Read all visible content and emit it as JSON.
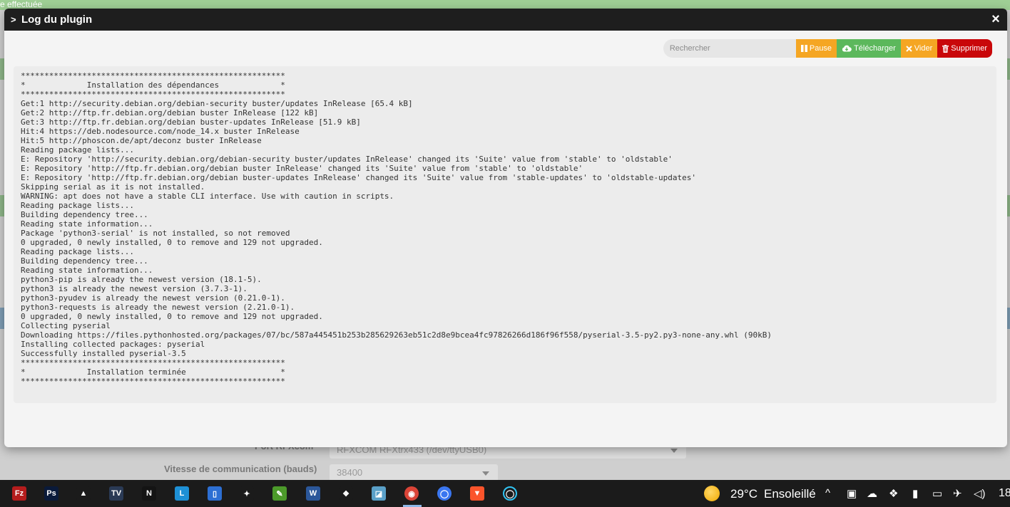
{
  "background": {
    "banner_text": "e effectuée",
    "port_label": "Port RFXcom",
    "port_value": "RFXCOM RFXtrx433 (/dev/ttyUSB0)",
    "speed_label": "Vitesse de communication (bauds)",
    "speed_value": "38400"
  },
  "modal": {
    "title": "Log du plugin",
    "close_glyph": "×",
    "search_placeholder": "Rechercher",
    "buttons": {
      "pause": "Pause",
      "download": "Télécharger",
      "clear": "Vider",
      "delete": "Supprimer"
    },
    "log_lines": [
      "********************************************************",
      "*             Installation des dépendances             *",
      "********************************************************",
      "Get:1 http://security.debian.org/debian-security buster/updates InRelease [65.4 kB]",
      "Get:2 http://ftp.fr.debian.org/debian buster InRelease [122 kB]",
      "Get:3 http://ftp.fr.debian.org/debian buster-updates InRelease [51.9 kB]",
      "Hit:4 https://deb.nodesource.com/node_14.x buster InRelease",
      "Hit:5 http://phoscon.de/apt/deconz buster InRelease",
      "Reading package lists...",
      "E: Repository 'http://security.debian.org/debian-security buster/updates InRelease' changed its 'Suite' value from 'stable' to 'oldstable'",
      "E: Repository 'http://ftp.fr.debian.org/debian buster InRelease' changed its 'Suite' value from 'stable' to 'oldstable'",
      "E: Repository 'http://ftp.fr.debian.org/debian buster-updates InRelease' changed its 'Suite' value from 'stable-updates' to 'oldstable-updates'",
      "Skipping serial as it is not installed.",
      "WARNING: apt does not have a stable CLI interface. Use with caution in scripts.",
      "Reading package lists...",
      "Building dependency tree...",
      "Reading state information...",
      "Package 'python3-serial' is not installed, so not removed",
      "0 upgraded, 0 newly installed, 0 to remove and 129 not upgraded.",
      "Reading package lists...",
      "Building dependency tree...",
      "Reading state information...",
      "python3-pip is already the newest version (18.1-5).",
      "python3 is already the newest version (3.7.3-1).",
      "python3-pyudev is already the newest version (0.21.0-1).",
      "python3-requests is already the newest version (2.21.0-1).",
      "0 upgraded, 0 newly installed, 0 to remove and 129 not upgraded.",
      "Collecting pyserial",
      "Downloading https://files.pythonhosted.org/packages/07/bc/587a445451b253b285629263eb51c2d8e9bcea4fc97826266d186f96f558/pyserial-3.5-py2.py3-none-any.whl (90kB)",
      "Installing collected packages: pyserial",
      "Successfully installed pyserial-3.5",
      "********************************************************",
      "*             Installation terminée                    *",
      "********************************************************"
    ]
  },
  "taskbar": {
    "icons": [
      {
        "name": "filezilla-icon",
        "glyph": "Fz",
        "bg": "#b51d1d"
      },
      {
        "name": "photoshop-icon",
        "glyph": "Ps",
        "bg": "#0a1a3a"
      },
      {
        "name": "vlc-icon",
        "glyph": "▲",
        "bg": "#1b1b1b"
      },
      {
        "name": "tv-app-icon",
        "glyph": "TV",
        "bg": "#2a3a55"
      },
      {
        "name": "netflix-icon",
        "glyph": "N",
        "bg": "#141414"
      },
      {
        "name": "l-app-icon",
        "glyph": "L",
        "bg": "#1e90d6"
      },
      {
        "name": "notes-app-icon",
        "glyph": "▯",
        "bg": "#2d6fd3"
      },
      {
        "name": "tools-app-icon",
        "glyph": "✦",
        "bg": "#1b1b1b"
      },
      {
        "name": "notepad-plus-icon",
        "glyph": "✎",
        "bg": "#4c9a2a"
      },
      {
        "name": "word-app-icon",
        "glyph": "W",
        "bg": "#2b579a"
      },
      {
        "name": "python-icon",
        "glyph": "❖",
        "bg": "#1b1b1b"
      },
      {
        "name": "editor-app-icon",
        "glyph": "◪",
        "bg": "#5aa0c8"
      },
      {
        "name": "chrome-icon",
        "glyph": "◉",
        "bg": "#db4437"
      },
      {
        "name": "signal-icon",
        "glyph": "◯",
        "bg": "#3a76f0"
      },
      {
        "name": "brave-icon",
        "glyph": "▼",
        "bg": "#fb542b"
      },
      {
        "name": "alexa-icon",
        "glyph": "◯",
        "bg": "#1b1b1b"
      }
    ],
    "weather_temp": "29°C",
    "weather_desc": "Ensoleillé",
    "tray": [
      "^",
      "▣",
      "☁",
      "❖",
      "▮",
      "▭",
      "✈",
      "◁)"
    ],
    "clock": "18"
  }
}
